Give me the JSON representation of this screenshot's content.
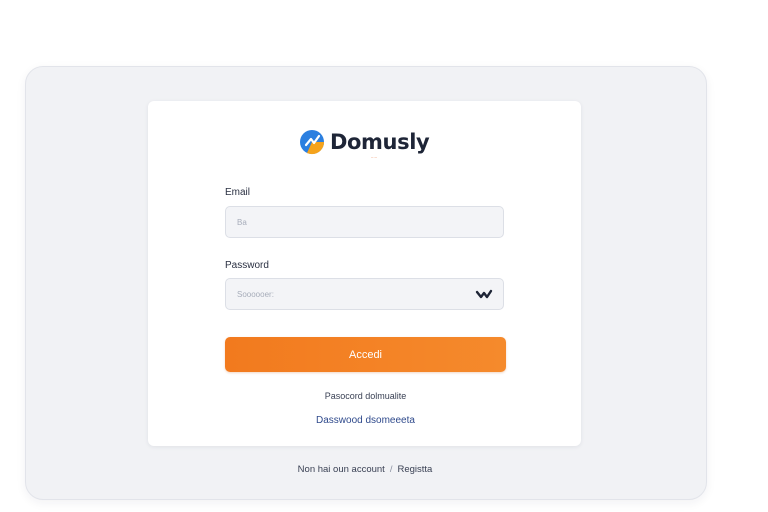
{
  "brand": {
    "name": "Domusly",
    "tagline": "·····",
    "logo_icon": "brand-logo-icon",
    "colors": {
      "blue": "#2b7fe0",
      "orange": "#f5a31c",
      "accent": "#e25b1c"
    }
  },
  "form": {
    "email": {
      "label": "Email",
      "value": "",
      "placeholder": "Ba"
    },
    "password": {
      "label": "Password",
      "value": "",
      "placeholder": "Soooooer:",
      "toggle_icon": "eye-icon"
    },
    "submit_label": "Accedi",
    "submit_color": "#f27a1e"
  },
  "links": {
    "forgot_primary": "Pasocord dolmualite",
    "forgot_secondary": "Dasswood dsomeeeta"
  },
  "footer": {
    "prompt": "Non hai oun account",
    "separator": "/",
    "register_label": "Registta"
  }
}
